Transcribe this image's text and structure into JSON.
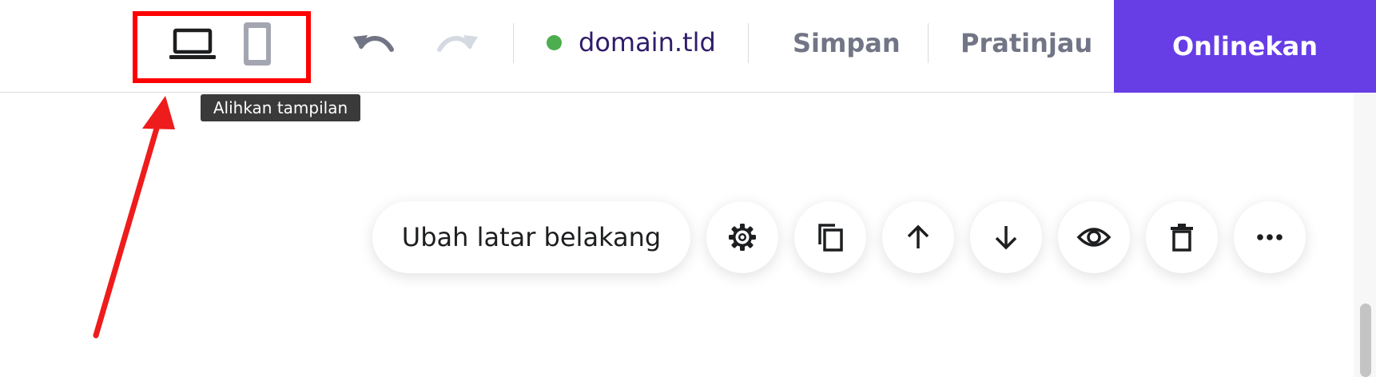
{
  "colors": {
    "accent": "#673de6",
    "status_online": "#4cae4f",
    "highlight": "#ff0000",
    "annotation_arrow": "#ee1c1c",
    "muted_text": "#727586",
    "dark_text": "#2f1c6a"
  },
  "header": {
    "view_toggle": {
      "desktop_icon": "laptop-icon",
      "mobile_icon": "phone-icon",
      "tooltip": "Alihkan tampilan"
    },
    "undo_icon": "undo-icon",
    "redo_icon": "redo-icon",
    "domain": {
      "label": "domain.tld",
      "status_icon": "status-dot-icon"
    },
    "save_label": "Simpan",
    "preview_label": "Pratinjau",
    "publish_label": "Onlinekan"
  },
  "section_toolbar": {
    "change_background_label": "Ubah latar belakang",
    "actions": [
      {
        "icon": "gear-icon"
      },
      {
        "icon": "duplicate-icon"
      },
      {
        "icon": "arrow-up-icon"
      },
      {
        "icon": "arrow-down-icon"
      },
      {
        "icon": "eye-icon"
      },
      {
        "icon": "trash-icon"
      },
      {
        "icon": "more-dots-icon"
      }
    ]
  }
}
